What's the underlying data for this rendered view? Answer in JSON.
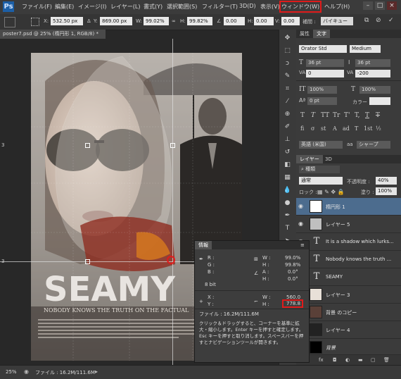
{
  "app": {
    "logo": "Ps"
  },
  "menu": {
    "items": [
      "ファイル(F)",
      "編集(E)",
      "イメージ(I)",
      "レイヤー(L)",
      "書式(Y)",
      "選択範囲(S)",
      "フィルター(T)",
      "3D(D)",
      "表示(V)",
      "ウィンドウ(W)",
      "ヘルプ(H)"
    ],
    "highlighted": "ウィンドウ(W)",
    "win_min": "–",
    "win_max": "□",
    "win_close": "×"
  },
  "options": {
    "x_label": "X:",
    "x_value": "532.50 px",
    "y_label": "Y:",
    "y_value": "869.00 px",
    "w_label": "W:",
    "w_value": "99.02%",
    "h_label": "H:",
    "h_value": "99.82%",
    "angle_label": "∠",
    "angle_value": "0.00",
    "hskew_label": "H:",
    "hskew_value": "0.00",
    "vskew_label": "V:",
    "vskew_value": "0.00",
    "interp_label": "補間 :",
    "interp_value": "バイキュー"
  },
  "document": {
    "tab": "poster7.psd @ 25% (楕円形 1, RGB/8) *",
    "tab_close": "×",
    "poster_title": "SEAMY",
    "poster_subtitle": "NOBODY KNOWS THE TRUTH ON THE FACTUAL",
    "ruler_3_top": "3",
    "ruler_3_mid": "3"
  },
  "status": {
    "zoom": "25%",
    "file": "ファイル : 16.2M/111.6M"
  },
  "char_panel": {
    "tabs": [
      "属性",
      "文字"
    ],
    "font": "Orator Std",
    "style": "Medium",
    "size": "36 pt",
    "leading": "36 pt",
    "kerning": "0",
    "tracking": "-200",
    "vscale": "100%",
    "hscale": "100%",
    "baseline": "0 pt",
    "color_label": "カラー :",
    "faux_styles": [
      "T",
      "T",
      "TT",
      "Tr",
      "T'",
      "T,",
      "T",
      "T"
    ],
    "opentype": [
      "fi",
      "σ",
      "st",
      "A",
      "ad",
      "T",
      "1st",
      "½"
    ],
    "lang": "英語 (米国)",
    "aa_label": "aa",
    "aa": "シャープ"
  },
  "layers_panel": {
    "tabs": [
      "レイヤー",
      "3D"
    ],
    "filter": "種類",
    "blend_mode": "通常",
    "opacity_label": "不透明度 :",
    "opacity": "40%",
    "lock_label": "ロック :",
    "fill_label": "塗り :",
    "fill": "100%",
    "layers": [
      {
        "name": "楕円形 1",
        "type": "shape",
        "selected": true
      },
      {
        "name": "レイヤー 5",
        "type": "pixel",
        "selected": false
      },
      {
        "name": "It is a shadow which lurks...",
        "type": "text",
        "selected": false
      },
      {
        "name": "Nobody knows the truth ...",
        "type": "text",
        "selected": false
      },
      {
        "name": "SEAMY",
        "type": "text",
        "selected": false
      },
      {
        "name": "レイヤー 3",
        "type": "pixel",
        "selected": false
      },
      {
        "name": "背景 のコピー",
        "type": "pixel",
        "selected": false
      },
      {
        "name": "レイヤー 4",
        "type": "pixel",
        "selected": false
      },
      {
        "name": "背景",
        "type": "pixel",
        "selected": false
      }
    ],
    "footer_icons": [
      "link-icon",
      "fx-icon",
      "mask-icon",
      "adjustment-icon",
      "folder-icon",
      "new-layer-icon",
      "trash-icon"
    ]
  },
  "info_panel": {
    "title": "情報",
    "r_label": "R :",
    "g_label": "G :",
    "b_label": "B :",
    "w_label": "W :",
    "w_value": "99.0%",
    "h_label": "H :",
    "h_value": "99.8%",
    "a_label": "A :",
    "a_value": "0.0°",
    "h2_label": "H :",
    "h2_value": "0.0°",
    "bit": "8 bit",
    "x_label": "X :",
    "y_label": "Y :",
    "w2_label": "W :",
    "w2_value": "560.0",
    "h3_label": "H :",
    "h3_value": "778.8",
    "file": "ファイル : 16.2M/111.6M",
    "help": "クリック＆ドラッグすると、コーナーを基準に拡大・縮小します。Enter キーを押すと確定します。Esc キーを押すと取り消します。スペースバーを押すとナビゲーションツールが開きます。"
  },
  "colors": {
    "highlight": "#e01b1b",
    "selected_layer": "#4c6c8e"
  }
}
